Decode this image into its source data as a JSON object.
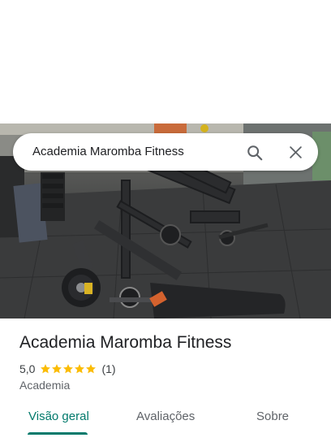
{
  "search": {
    "query": "Academia Maromba Fitness"
  },
  "place": {
    "name": "Academia Maromba Fitness",
    "rating": "5,0",
    "stars": 5,
    "review_count": "(1)",
    "category": "Academia"
  },
  "tabs": [
    {
      "label": "Visão geral",
      "active": true
    },
    {
      "label": "Avaliações",
      "active": false
    },
    {
      "label": "Sobre",
      "active": false
    }
  ],
  "colors": {
    "accent": "#00796b",
    "star": "#fbbc04",
    "text": "#202124",
    "secondary_text": "#5f6368"
  },
  "icons": [
    "search-icon",
    "close-icon",
    "star-icon"
  ]
}
